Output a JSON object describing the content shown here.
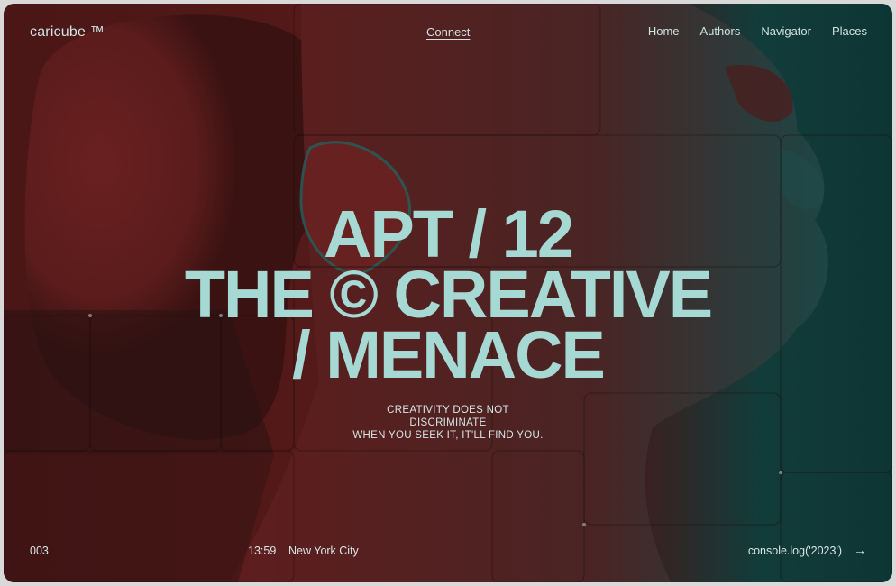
{
  "header": {
    "logo": "caricube ™",
    "connect_label": "Connect",
    "nav": [
      "Home",
      "Authors",
      "Navigator",
      "Places"
    ]
  },
  "hero": {
    "line1": "APT / 12",
    "line2": "THE © CREATIVE",
    "line3": "/ MENACE"
  },
  "tagline": {
    "line1": "CREATIVITY DOES NOT",
    "line2": "DISCRIMINATE",
    "line3": "WHEN YOU SEEK IT, IT'LL FIND YOU."
  },
  "footer": {
    "counter": "003",
    "time": "13:59",
    "city": "New York City",
    "code_link": "console.log('2023')",
    "arrow_icon": "arrow-right-icon"
  },
  "colors": {
    "hero_text": "#a6d9d4",
    "background_red": "#5a1a1a",
    "background_teal": "#0f3a38"
  }
}
